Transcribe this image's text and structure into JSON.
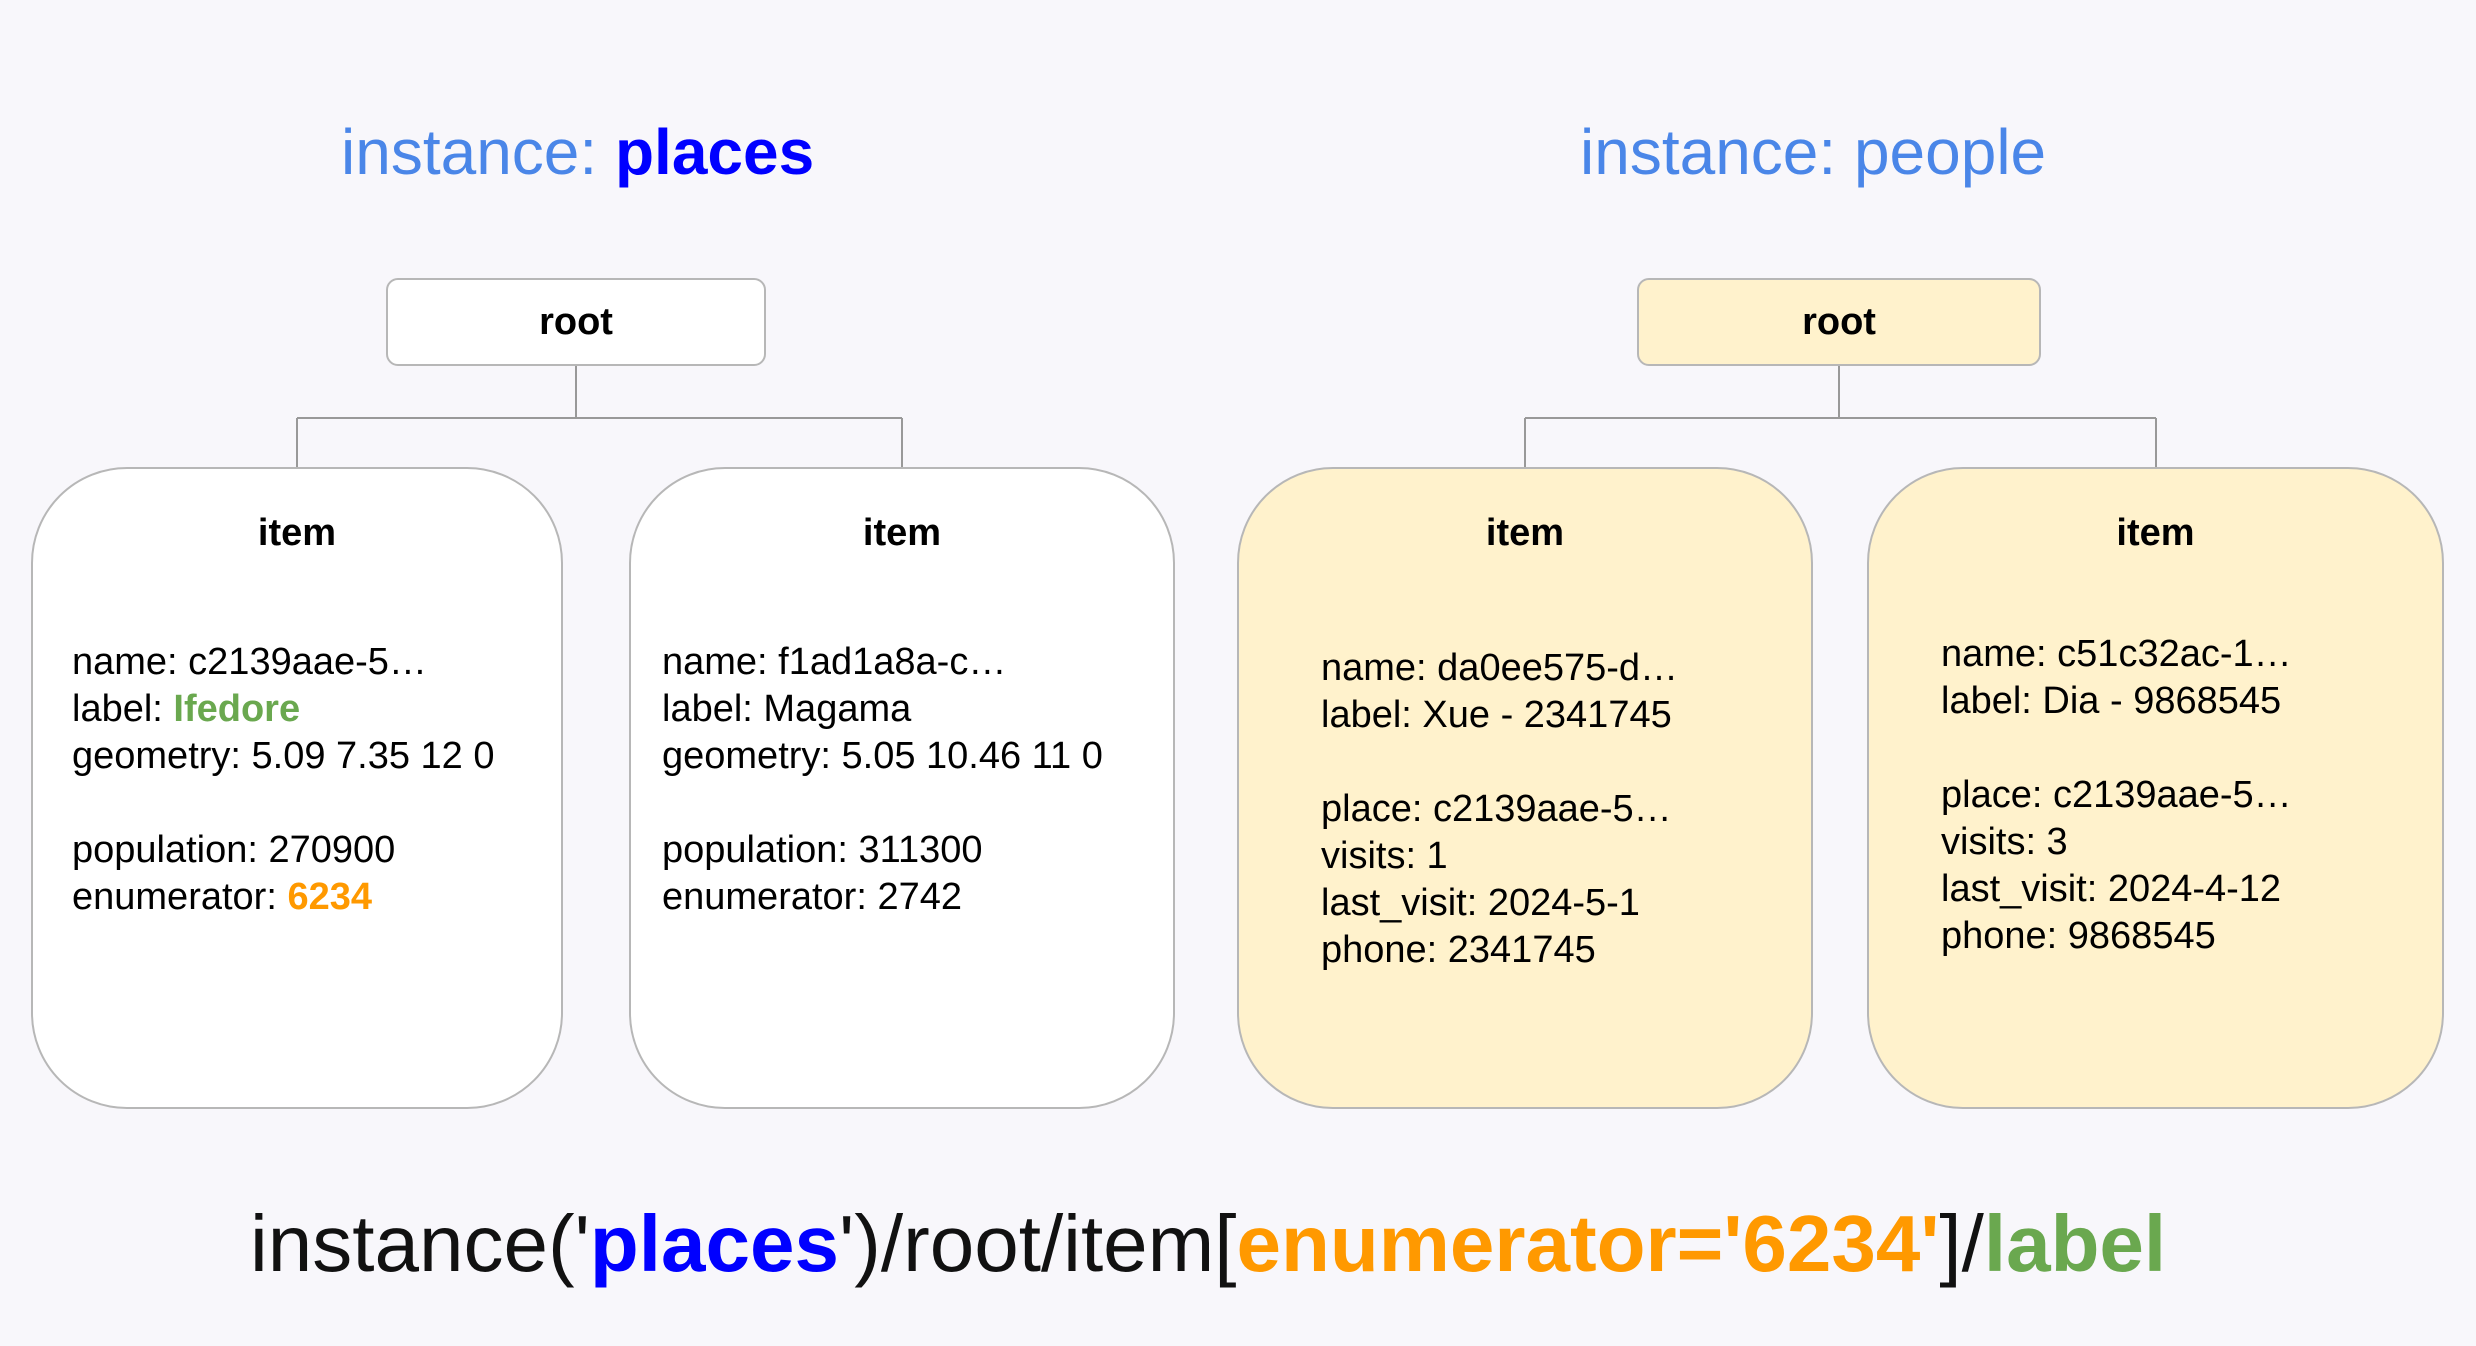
{
  "headings": {
    "places": {
      "prefix": "instance: ",
      "name": "places"
    },
    "people": {
      "prefix": "instance: ",
      "name": "people"
    }
  },
  "roots": {
    "places": "root",
    "people": "root"
  },
  "items": [
    {
      "title": "item",
      "name": "name: c2139aae-5…",
      "label_prefix": "label: ",
      "label_value": "Ifedore",
      "geometry": "geometry: 5.09 7.35 12 0",
      "population": "population: 270900",
      "enumerator_prefix": "enumerator: ",
      "enumerator_value": "6234"
    },
    {
      "title": "item",
      "name": "name: f1ad1a8a-c…",
      "label": "label: Magama",
      "geometry": "geometry: 5.05 10.46 11 0",
      "population": "population: 311300",
      "enumerator": "enumerator: 2742"
    },
    {
      "title": "item",
      "name": "name: da0ee575-d…",
      "label": "label: Xue - 2341745",
      "place": "place: c2139aae-5…",
      "visits": "visits: 1",
      "last_visit": "last_visit: 2024-5-1",
      "phone": "phone: 2341745"
    },
    {
      "title": "item",
      "name": "name: c51c32ac-1…",
      "label": "label: Dia - 9868545",
      "place": "place: c2139aae-5…",
      "visits": "visits: 3",
      "last_visit": "last_visit: 2024-4-12",
      "phone": "phone: 9868545"
    }
  ],
  "query": {
    "p1": "instance('",
    "instance": "places",
    "p2": "')/root/item[",
    "predicate": "enumerator='6234'",
    "p3": "]/",
    "target": "label"
  },
  "colors": {
    "heading": "#4a86e8",
    "heading_strong": "#0000ff",
    "places_fill": "#ffffff",
    "people_fill": "#fff2cc",
    "border": "#b7b7b7",
    "label_highlight": "#6aa84f",
    "enumerator_highlight": "#ff9900"
  }
}
